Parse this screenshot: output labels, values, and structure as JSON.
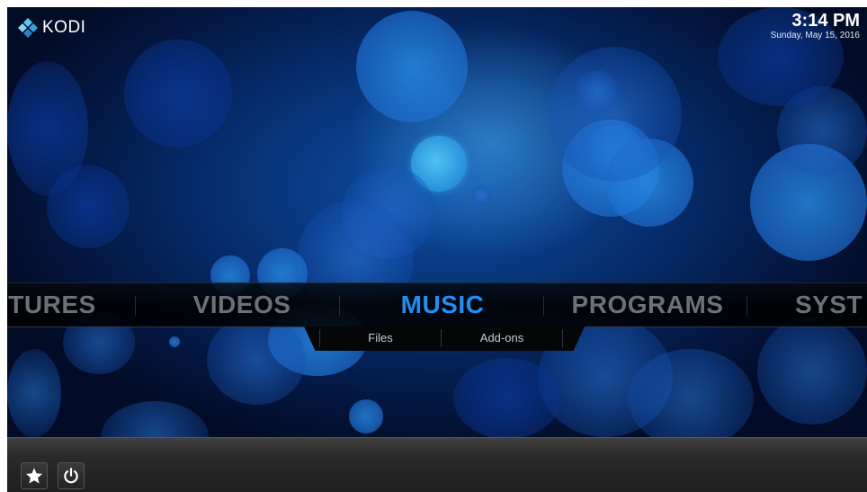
{
  "app": {
    "logo_text": "KODI",
    "logo_icon": "kodi-logo-icon"
  },
  "clock": {
    "time": "3:14 PM",
    "date": "Sunday, May 15, 2016"
  },
  "menu": {
    "items": [
      {
        "label": "TURES"
      },
      {
        "label": "VIDEOS"
      },
      {
        "label": "MUSIC",
        "active": true
      },
      {
        "label": "PROGRAMS"
      },
      {
        "label": "SYST"
      }
    ],
    "active_color": "#1f8ef5",
    "inactive_color": "#6d7176"
  },
  "submenu": {
    "items": [
      {
        "label": "Files"
      },
      {
        "label": "Add-ons"
      }
    ]
  },
  "bottom_bar": {
    "buttons": [
      {
        "icon": "star-icon",
        "label": "favourites"
      },
      {
        "icon": "power-icon",
        "label": "power"
      }
    ]
  },
  "colors": {
    "accent": "#1f8ef5",
    "background_deep": "#03102a",
    "bubble_bright": "#4fc0f0"
  }
}
